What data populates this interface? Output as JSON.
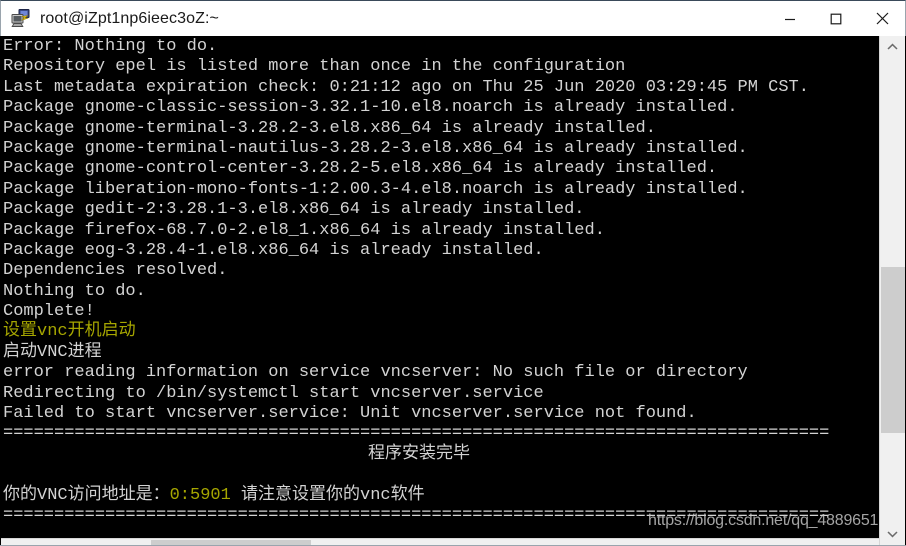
{
  "window": {
    "title": "root@iZpt1np6ieec3oZ:~",
    "icon": "putty-terminal-icon",
    "controls": {
      "minimize": "minimize-icon",
      "maximize": "maximize-icon",
      "close": "close-icon"
    }
  },
  "terminal": {
    "background": "#000000",
    "foreground": "#d3d3d3",
    "accent_yellow": "#a6a600",
    "lines": [
      {
        "text": "Error: Nothing to do.",
        "color": "white"
      },
      {
        "text": "Repository epel is listed more than once in the configuration",
        "color": "white"
      },
      {
        "text": "Last metadata expiration check: 0:21:12 ago on Thu 25 Jun 2020 03:29:45 PM CST.",
        "color": "white"
      },
      {
        "text": "Package gnome-classic-session-3.32.1-10.el8.noarch is already installed.",
        "color": "white"
      },
      {
        "text": "Package gnome-terminal-3.28.2-3.el8.x86_64 is already installed.",
        "color": "white"
      },
      {
        "text": "Package gnome-terminal-nautilus-3.28.2-3.el8.x86_64 is already installed.",
        "color": "white"
      },
      {
        "text": "Package gnome-control-center-3.28.2-5.el8.x86_64 is already installed.",
        "color": "white"
      },
      {
        "text": "Package liberation-mono-fonts-1:2.00.3-4.el8.noarch is already installed.",
        "color": "white"
      },
      {
        "text": "Package gedit-2:3.28.1-3.el8.x86_64 is already installed.",
        "color": "white"
      },
      {
        "text": "Package firefox-68.7.0-2.el8_1.x86_64 is already installed.",
        "color": "white"
      },
      {
        "text": "Package eog-3.28.4-1.el8.x86_64 is already installed.",
        "color": "white"
      },
      {
        "text": "Dependencies resolved.",
        "color": "white"
      },
      {
        "text": "Nothing to do.",
        "color": "white"
      },
      {
        "text": "Complete!",
        "color": "white"
      },
      {
        "text": "设置vnc开机启动",
        "color": "yellow"
      },
      {
        "text": "启动VNC进程",
        "color": "white"
      },
      {
        "text": "error reading information on service vncserver: No such file or directory",
        "color": "white"
      },
      {
        "text": "Redirecting to /bin/systemctl start vncserver.service",
        "color": "white"
      },
      {
        "text": "Failed to start vncserver.service: Unit vncserver.service not found.",
        "color": "white"
      },
      {
        "text": "=================================================================================",
        "color": "white"
      },
      {
        "text": "程序安装完毕",
        "color": "white",
        "indent": true
      },
      {
        "text": "",
        "color": "white"
      },
      {
        "text_parts": [
          {
            "text": "你的VNC访问地址是：",
            "color": "white"
          },
          {
            "text": "0:5901",
            "color": "yellow"
          },
          {
            "text": " 请注意设置你的vnc软件",
            "color": "white"
          }
        ]
      },
      {
        "text": "=================================================================================",
        "color": "white"
      }
    ]
  },
  "watermark": {
    "text": "https://blog.csdn.net/qq_4889651"
  },
  "scrollbars": {
    "vertical": {
      "up_arrow": "chevron-up-icon",
      "down_arrow": "chevron-down-icon",
      "thumb": "vertical-scroll-thumb"
    },
    "horizontal": {
      "thumb": "horizontal-scroll-thumb"
    }
  }
}
